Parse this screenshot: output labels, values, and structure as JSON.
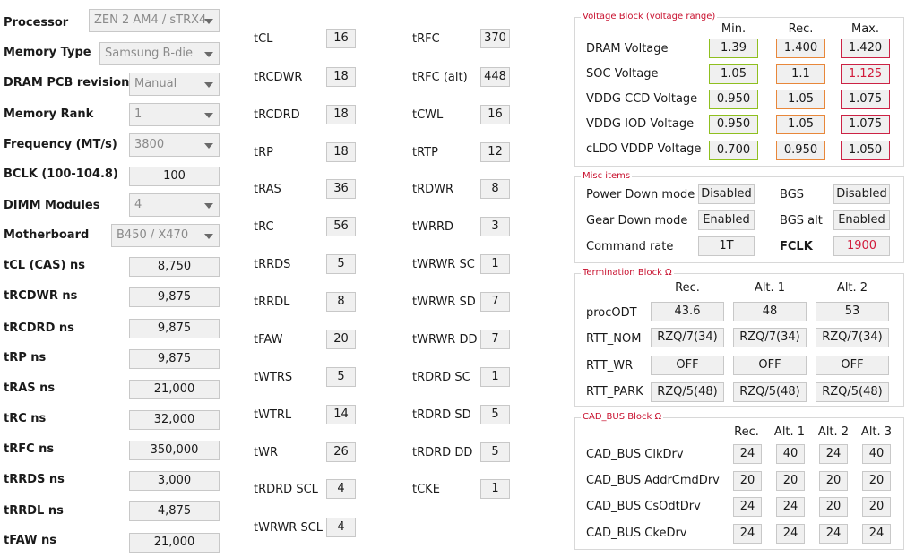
{
  "left": {
    "processor": {
      "label": "Processor",
      "value": "ZEN 2 AM4 / sTRX4"
    },
    "memory_type": {
      "label": "Memory Type",
      "value": "Samsung B-die"
    },
    "pcb": {
      "label": "DRAM PCB revision",
      "value": "Manual"
    },
    "rank": {
      "label": "Memory Rank",
      "value": "1"
    },
    "frequency": {
      "label": "Frequency (MT/s)",
      "value": "3800"
    },
    "bclk": {
      "label": "BCLK (100-104.8)",
      "value": "100"
    },
    "dimm": {
      "label": "DIMM Modules",
      "value": "4"
    },
    "motherboard": {
      "label": "Motherboard",
      "value": "B450 / X470"
    },
    "ns": [
      {
        "label": "tCL (CAS) ns",
        "value": "8,750"
      },
      {
        "label": "tRCDWR ns",
        "value": "9,875"
      },
      {
        "label": "tRCDRD ns",
        "value": "9,875"
      },
      {
        "label": "tRP ns",
        "value": "9,875"
      },
      {
        "label": "tRAS ns",
        "value": "21,000"
      },
      {
        "label": "tRC ns",
        "value": "32,000"
      },
      {
        "label": "tRFC ns",
        "value": "350,000"
      },
      {
        "label": "tRRDS ns",
        "value": "3,000"
      },
      {
        "label": "tRRDL ns",
        "value": "4,875"
      },
      {
        "label": "tFAW ns",
        "value": "21,000"
      }
    ]
  },
  "timings_col1": [
    {
      "label": "tCL",
      "value": "16"
    },
    {
      "label": "tRCDWR",
      "value": "18"
    },
    {
      "label": "tRCDRD",
      "value": "18"
    },
    {
      "label": "tRP",
      "value": "18"
    },
    {
      "label": "tRAS",
      "value": "36"
    },
    {
      "label": "tRC",
      "value": "56"
    },
    {
      "label": "tRRDS",
      "value": "5"
    },
    {
      "label": "tRRDL",
      "value": "8"
    },
    {
      "label": "tFAW",
      "value": "20"
    },
    {
      "label": "tWTRS",
      "value": "5"
    },
    {
      "label": "tWTRL",
      "value": "14"
    },
    {
      "label": "tWR",
      "value": "26"
    },
    {
      "label": "tRDRD SCL",
      "value": "4"
    },
    {
      "label": "tWRWR SCL",
      "value": "4"
    }
  ],
  "timings_col2": [
    {
      "label": "tRFC",
      "value": "370"
    },
    {
      "label": "tRFC (alt)",
      "value": "448"
    },
    {
      "label": "tCWL",
      "value": "16"
    },
    {
      "label": "tRTP",
      "value": "12"
    },
    {
      "label": "tRDWR",
      "value": "8"
    },
    {
      "label": "tWRRD",
      "value": "3"
    },
    {
      "label": "tWRWR SC",
      "value": "1"
    },
    {
      "label": "tWRWR SD",
      "value": "7"
    },
    {
      "label": "tWRWR DD",
      "value": "7"
    },
    {
      "label": "tRDRD SC",
      "value": "1"
    },
    {
      "label": "tRDRD SD",
      "value": "5"
    },
    {
      "label": "tRDRD DD",
      "value": "5"
    },
    {
      "label": "tCKE",
      "value": "1"
    }
  ],
  "voltage": {
    "title": "Voltage Block (voltage range)",
    "headers": [
      "Min.",
      "Rec.",
      "Max."
    ],
    "rows": [
      {
        "label": "DRAM Voltage",
        "min": "1.39",
        "rec": "1.400",
        "max": "1.420"
      },
      {
        "label": "SOC Voltage",
        "min": "1.05",
        "rec": "1.1",
        "max": "1.125"
      },
      {
        "label": "VDDG  CCD Voltage",
        "min": "0.950",
        "rec": "1.05",
        "max": "1.075"
      },
      {
        "label": "VDDG  IOD Voltage",
        "min": "0.950",
        "rec": "1.05",
        "max": "1.075"
      },
      {
        "label": "cLDO VDDP Voltage",
        "min": "0.700",
        "rec": "0.950",
        "max": "1.050"
      }
    ],
    "colors": {
      "min": "#8fbf1f",
      "rec": "#e8873a",
      "max": "#cc2244"
    }
  },
  "misc": {
    "title": "Misc items",
    "power_down": {
      "label": "Power Down mode",
      "value": "Disabled"
    },
    "bgs": {
      "label": "BGS",
      "value": "Disabled"
    },
    "gear_down": {
      "label": "Gear Down mode",
      "value": "Enabled"
    },
    "bgs_alt": {
      "label": "BGS alt",
      "value": "Enabled"
    },
    "command_rate": {
      "label": "Command rate",
      "value": "1T"
    },
    "fclk": {
      "label": "FCLK",
      "value": "1900"
    }
  },
  "termination": {
    "title": "Termination Block Ω",
    "headers": [
      "Rec.",
      "Alt. 1",
      "Alt. 2"
    ],
    "rows": [
      {
        "label": "procODT",
        "values": [
          "43.6",
          "48",
          "53"
        ]
      },
      {
        "label": "RTT_NOM",
        "values": [
          "RZQ/7(34)",
          "RZQ/7(34)",
          "RZQ/7(34)"
        ]
      },
      {
        "label": "RTT_WR",
        "values": [
          "OFF",
          "OFF",
          "OFF"
        ]
      },
      {
        "label": "RTT_PARK",
        "values": [
          "RZQ/5(48)",
          "RZQ/5(48)",
          "RZQ/5(48)"
        ]
      }
    ]
  },
  "cadbus": {
    "title": "CAD_BUS Block Ω",
    "headers": [
      "Rec.",
      "Alt. 1",
      "Alt. 2",
      "Alt. 3"
    ],
    "rows": [
      {
        "label": "CAD_BUS ClkDrv",
        "values": [
          "24",
          "40",
          "24",
          "40"
        ]
      },
      {
        "label": "CAD_BUS AddrCmdDrv",
        "values": [
          "20",
          "20",
          "20",
          "20"
        ]
      },
      {
        "label": "CAD_BUS CsOdtDrv",
        "values": [
          "24",
          "24",
          "20",
          "20"
        ]
      },
      {
        "label": "CAD_BUS CkeDrv",
        "values": [
          "24",
          "24",
          "24",
          "24"
        ]
      }
    ]
  },
  "accent_color": "#c8102e"
}
